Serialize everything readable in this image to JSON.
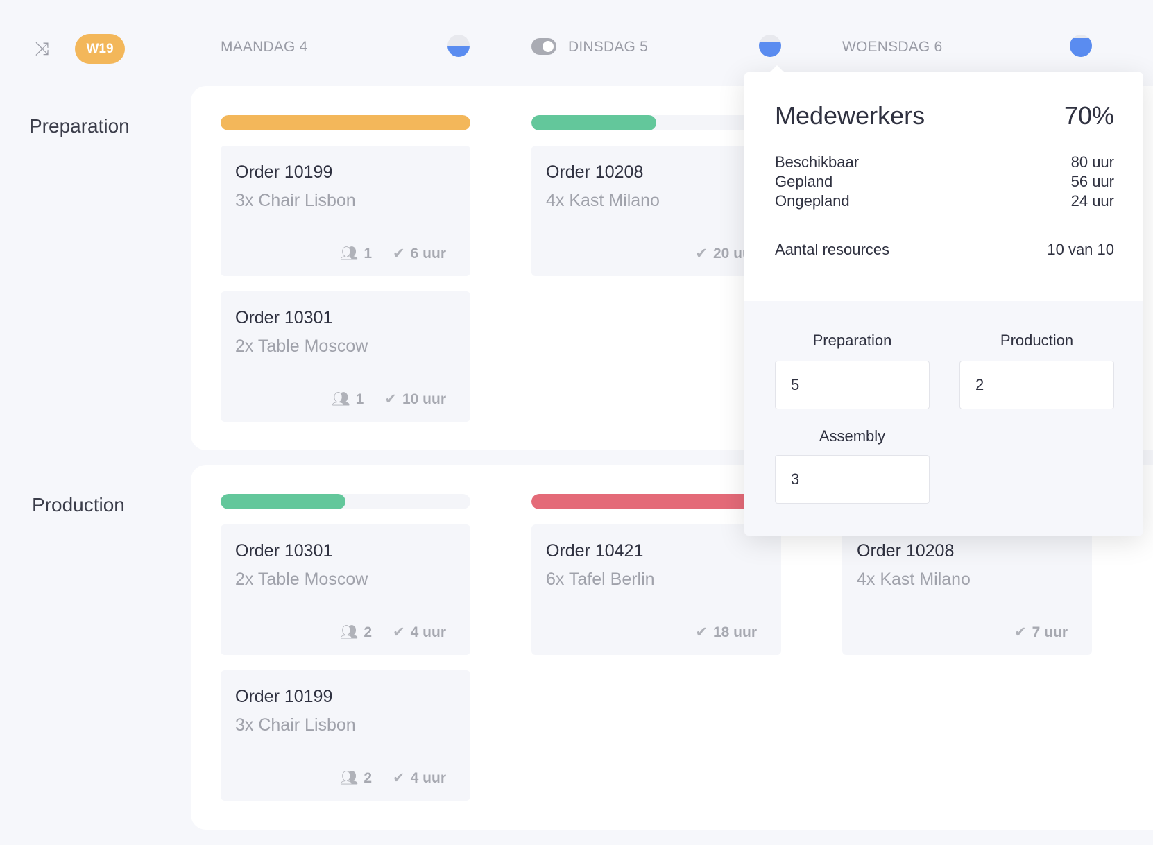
{
  "header": {
    "week": "W19",
    "days": [
      {
        "label": "MAANDAG 4",
        "load": 0.5
      },
      {
        "label": "DINSDAG 5",
        "load": 0.7
      },
      {
        "label": "WOENSDAG 6",
        "load": 0.85
      }
    ]
  },
  "colors": {
    "orange": "#f3b75a",
    "green": "#63c79b",
    "red": "#e46a78",
    "blue": "#5a8cf0"
  },
  "rows": [
    {
      "label": "Preparation",
      "bars": [
        {
          "fill": 1.0,
          "color": "orange"
        },
        {
          "fill": 0.5,
          "color": "green"
        }
      ],
      "cards": [
        {
          "col": 0,
          "title": "Order 10199",
          "sub": "3x Chair Lisbon",
          "people": "1",
          "hours": "6 uur"
        },
        {
          "col": 0,
          "title": "Order 10301",
          "sub": "2x Table Moscow",
          "people": "1",
          "hours": "10 uur"
        },
        {
          "col": 1,
          "title": "Order 10208",
          "sub": "4x Kast Milano",
          "hours": "20 uur"
        }
      ]
    },
    {
      "label": "Production",
      "bars": [
        {
          "fill": 0.5,
          "color": "green"
        },
        {
          "fill": 1.0,
          "color": "red"
        }
      ],
      "cards": [
        {
          "col": 0,
          "title": "Order 10301",
          "sub": "2x Table Moscow",
          "people": "2",
          "hours": "4 uur"
        },
        {
          "col": 0,
          "title": "Order 10199",
          "sub": "3x Chair Lisbon",
          "people": "2",
          "hours": "4 uur"
        },
        {
          "col": 1,
          "title": "Order 10421",
          "sub": "6x Tafel Berlin",
          "hours": "18 uur"
        },
        {
          "col": 2,
          "title": "Order 10208",
          "sub": "4x Kast Milano",
          "hours": "7 uur"
        }
      ]
    }
  ],
  "popup": {
    "title": "Medewerkers",
    "percent": "70%",
    "stats": [
      {
        "label": "Beschikbaar",
        "value": "80 uur"
      },
      {
        "label": "Gepland",
        "value": "56 uur"
      },
      {
        "label": "Ongepland",
        "value": "24 uur"
      }
    ],
    "resources": {
      "label": "Aantal resources",
      "value": "10 van 10"
    },
    "fields": [
      {
        "label": "Preparation",
        "value": "5"
      },
      {
        "label": "Production",
        "value": "2"
      },
      {
        "label": "Assembly",
        "value": "3"
      }
    ]
  }
}
